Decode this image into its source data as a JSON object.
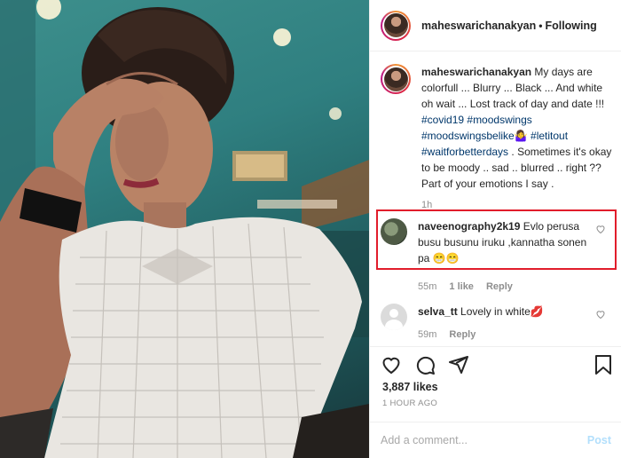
{
  "post": {
    "image_alt": "Woman in white lace top with hand on forehead in a teal cafe",
    "username": "maheswarichanakyan",
    "separator": "•",
    "follow_status": "Following"
  },
  "caption": {
    "username": "maheswarichanakyan",
    "text_1": " My days are colorfull ... Blurry ... Black ... And white oh wait ... Lost track of day and date !!! ",
    "tag_1": "#covid19",
    "tag_2": "#moodswings",
    "tag_3": "#moodswingsbelike",
    "emoji_1": "🤷‍♀️",
    "tag_4": "#letitout",
    "tag_5": "#waitforbetterdays",
    "text_2": ". Sometimes it's okay to be moody .. sad .. blurred .. right ?? Part of your emotions I say .",
    "time": "1h"
  },
  "comments": [
    {
      "username": "naveenography2k19",
      "text": " Evlo perusa busu busunu iruku ,kannatha sonen pa 😁😁",
      "time": "55m",
      "likes": "1 like",
      "reply": "Reply"
    },
    {
      "username": "selva_tt",
      "text": " Lovely in white💋",
      "time": "59m",
      "reply": "Reply"
    }
  ],
  "actions": {
    "likes": "3,887 likes",
    "posted": "1 HOUR AGO"
  },
  "add_comment": {
    "placeholder": "Add a comment...",
    "post_label": "Post"
  },
  "colors": {
    "link": "#00376b",
    "highlight": "#e11d2b",
    "post_disabled": "#b2dffc"
  }
}
